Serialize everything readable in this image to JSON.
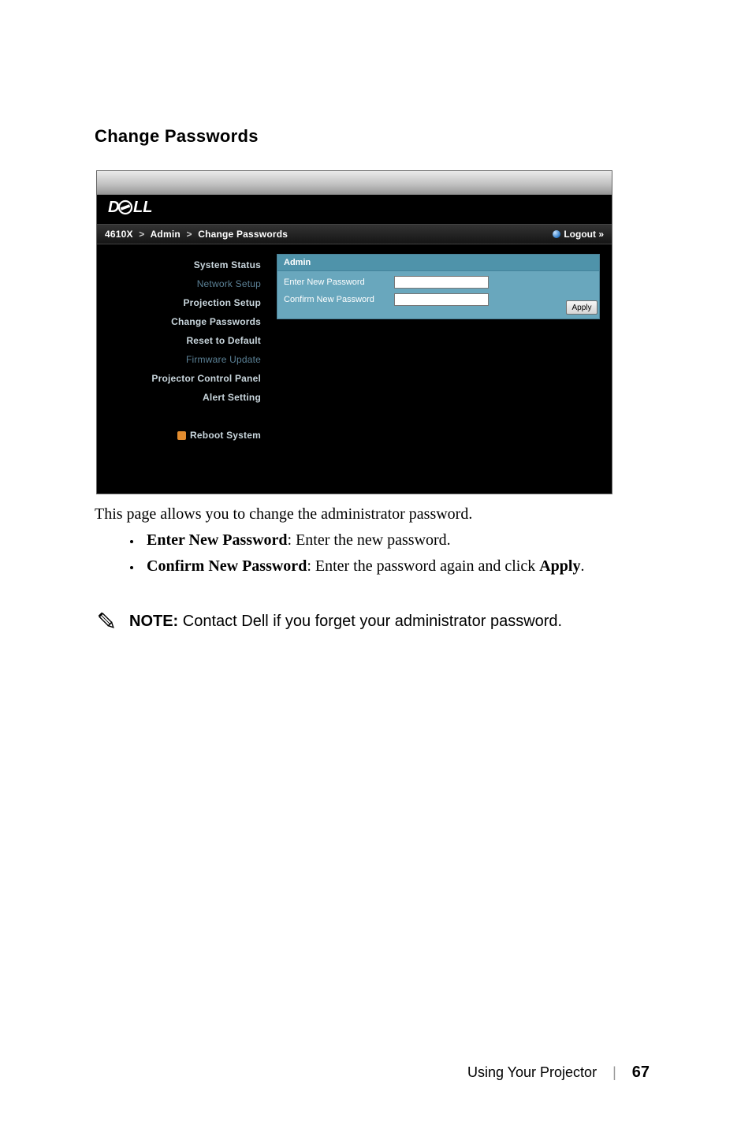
{
  "section_title": "Change Passwords",
  "breadcrumb": {
    "model": "4610X",
    "area": "Admin",
    "page": "Change Passwords"
  },
  "logout_label": "Logout »",
  "sidebar": {
    "items": [
      {
        "label": "System Status"
      },
      {
        "label": "Network Setup"
      },
      {
        "label": "Projection Setup"
      },
      {
        "label": "Change Passwords"
      },
      {
        "label": "Reset to Default"
      },
      {
        "label": "Firmware Update"
      },
      {
        "label": "Projector Control Panel"
      },
      {
        "label": "Alert Setting"
      }
    ],
    "reboot": "Reboot System"
  },
  "admin_box": {
    "title": "Admin",
    "row1_label": "Enter New Password",
    "row2_label": "Confirm New Password",
    "apply_label": "Apply"
  },
  "description": "This page allows you to change the administrator password.",
  "bullets": {
    "b1_strong": "Enter New Password",
    "b1_rest": ": Enter the new password.",
    "b2_strong": "Confirm New Password",
    "b2_rest": ": Enter the password again and click ",
    "b2_strong2": "Apply",
    "b2_tail": "."
  },
  "note": {
    "label": "NOTE:",
    "text": " Contact Dell if you forget your administrator password."
  },
  "footer": {
    "section": "Using Your Projector",
    "page": "67"
  }
}
